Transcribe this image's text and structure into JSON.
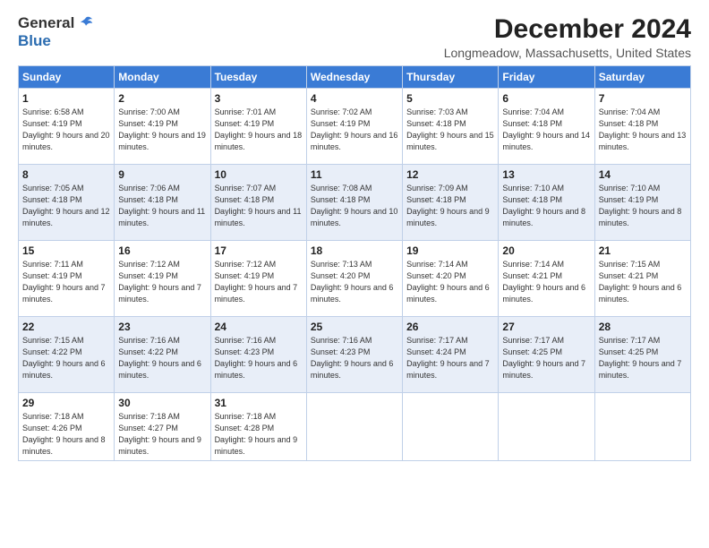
{
  "header": {
    "logo_general": "General",
    "logo_blue": "Blue",
    "title": "December 2024",
    "location": "Longmeadow, Massachusetts, United States"
  },
  "days_of_week": [
    "Sunday",
    "Monday",
    "Tuesday",
    "Wednesday",
    "Thursday",
    "Friday",
    "Saturday"
  ],
  "weeks": [
    [
      {
        "day": "1",
        "sunrise": "6:58 AM",
        "sunset": "4:19 PM",
        "daylight": "9 hours and 20 minutes."
      },
      {
        "day": "2",
        "sunrise": "7:00 AM",
        "sunset": "4:19 PM",
        "daylight": "9 hours and 19 minutes."
      },
      {
        "day": "3",
        "sunrise": "7:01 AM",
        "sunset": "4:19 PM",
        "daylight": "9 hours and 18 minutes."
      },
      {
        "day": "4",
        "sunrise": "7:02 AM",
        "sunset": "4:19 PM",
        "daylight": "9 hours and 16 minutes."
      },
      {
        "day": "5",
        "sunrise": "7:03 AM",
        "sunset": "4:18 PM",
        "daylight": "9 hours and 15 minutes."
      },
      {
        "day": "6",
        "sunrise": "7:04 AM",
        "sunset": "4:18 PM",
        "daylight": "9 hours and 14 minutes."
      },
      {
        "day": "7",
        "sunrise": "7:04 AM",
        "sunset": "4:18 PM",
        "daylight": "9 hours and 13 minutes."
      }
    ],
    [
      {
        "day": "8",
        "sunrise": "7:05 AM",
        "sunset": "4:18 PM",
        "daylight": "9 hours and 12 minutes."
      },
      {
        "day": "9",
        "sunrise": "7:06 AM",
        "sunset": "4:18 PM",
        "daylight": "9 hours and 11 minutes."
      },
      {
        "day": "10",
        "sunrise": "7:07 AM",
        "sunset": "4:18 PM",
        "daylight": "9 hours and 11 minutes."
      },
      {
        "day": "11",
        "sunrise": "7:08 AM",
        "sunset": "4:18 PM",
        "daylight": "9 hours and 10 minutes."
      },
      {
        "day": "12",
        "sunrise": "7:09 AM",
        "sunset": "4:18 PM",
        "daylight": "9 hours and 9 minutes."
      },
      {
        "day": "13",
        "sunrise": "7:10 AM",
        "sunset": "4:18 PM",
        "daylight": "9 hours and 8 minutes."
      },
      {
        "day": "14",
        "sunrise": "7:10 AM",
        "sunset": "4:19 PM",
        "daylight": "9 hours and 8 minutes."
      }
    ],
    [
      {
        "day": "15",
        "sunrise": "7:11 AM",
        "sunset": "4:19 PM",
        "daylight": "9 hours and 7 minutes."
      },
      {
        "day": "16",
        "sunrise": "7:12 AM",
        "sunset": "4:19 PM",
        "daylight": "9 hours and 7 minutes."
      },
      {
        "day": "17",
        "sunrise": "7:12 AM",
        "sunset": "4:19 PM",
        "daylight": "9 hours and 7 minutes."
      },
      {
        "day": "18",
        "sunrise": "7:13 AM",
        "sunset": "4:20 PM",
        "daylight": "9 hours and 6 minutes."
      },
      {
        "day": "19",
        "sunrise": "7:14 AM",
        "sunset": "4:20 PM",
        "daylight": "9 hours and 6 minutes."
      },
      {
        "day": "20",
        "sunrise": "7:14 AM",
        "sunset": "4:21 PM",
        "daylight": "9 hours and 6 minutes."
      },
      {
        "day": "21",
        "sunrise": "7:15 AM",
        "sunset": "4:21 PM",
        "daylight": "9 hours and 6 minutes."
      }
    ],
    [
      {
        "day": "22",
        "sunrise": "7:15 AM",
        "sunset": "4:22 PM",
        "daylight": "9 hours and 6 minutes."
      },
      {
        "day": "23",
        "sunrise": "7:16 AM",
        "sunset": "4:22 PM",
        "daylight": "9 hours and 6 minutes."
      },
      {
        "day": "24",
        "sunrise": "7:16 AM",
        "sunset": "4:23 PM",
        "daylight": "9 hours and 6 minutes."
      },
      {
        "day": "25",
        "sunrise": "7:16 AM",
        "sunset": "4:23 PM",
        "daylight": "9 hours and 6 minutes."
      },
      {
        "day": "26",
        "sunrise": "7:17 AM",
        "sunset": "4:24 PM",
        "daylight": "9 hours and 7 minutes."
      },
      {
        "day": "27",
        "sunrise": "7:17 AM",
        "sunset": "4:25 PM",
        "daylight": "9 hours and 7 minutes."
      },
      {
        "day": "28",
        "sunrise": "7:17 AM",
        "sunset": "4:25 PM",
        "daylight": "9 hours and 7 minutes."
      }
    ],
    [
      {
        "day": "29",
        "sunrise": "7:18 AM",
        "sunset": "4:26 PM",
        "daylight": "9 hours and 8 minutes."
      },
      {
        "day": "30",
        "sunrise": "7:18 AM",
        "sunset": "4:27 PM",
        "daylight": "9 hours and 9 minutes."
      },
      {
        "day": "31",
        "sunrise": "7:18 AM",
        "sunset": "4:28 PM",
        "daylight": "9 hours and 9 minutes."
      },
      null,
      null,
      null,
      null
    ]
  ],
  "labels": {
    "sunrise": "Sunrise:",
    "sunset": "Sunset:",
    "daylight": "Daylight:"
  },
  "shaded_rows": [
    1,
    3
  ]
}
